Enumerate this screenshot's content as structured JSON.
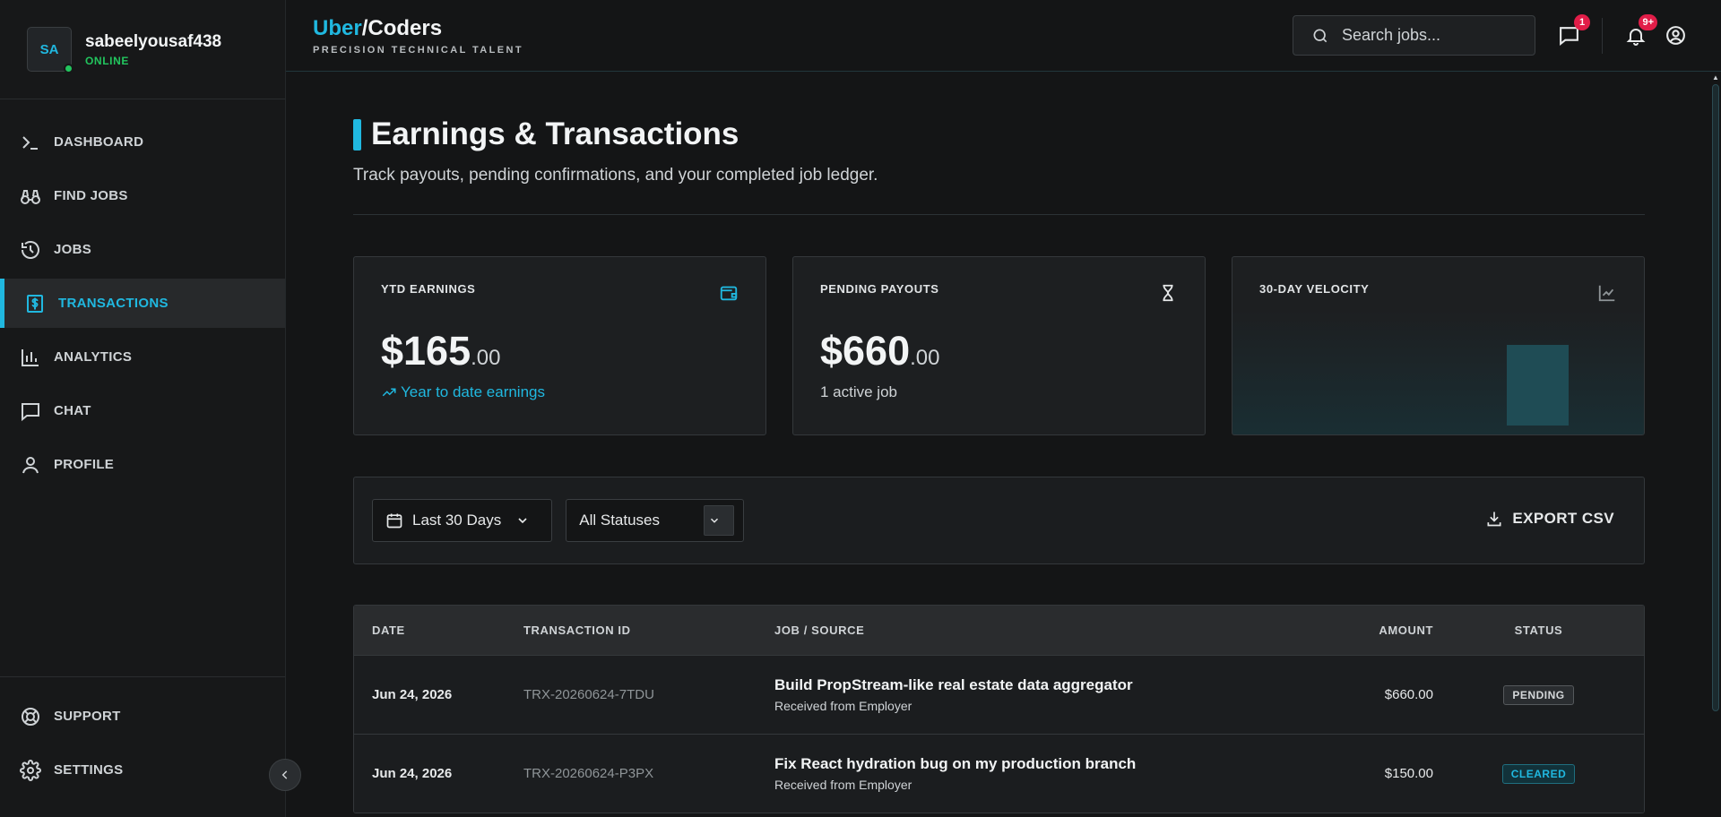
{
  "user": {
    "initials": "SA",
    "name": "sabeelyousaf438",
    "status": "ONLINE"
  },
  "nav": {
    "items": [
      {
        "label": "DASHBOARD",
        "icon": "terminal-icon"
      },
      {
        "label": "FIND JOBS",
        "icon": "binoculars-icon"
      },
      {
        "label": "JOBS",
        "icon": "history-icon"
      },
      {
        "label": "TRANSACTIONS",
        "icon": "dollar-receipt-icon",
        "active": true
      },
      {
        "label": "ANALYTICS",
        "icon": "bar-chart-icon"
      },
      {
        "label": "CHAT",
        "icon": "chat-icon"
      },
      {
        "label": "PROFILE",
        "icon": "user-icon"
      }
    ],
    "bottom": [
      {
        "label": "SUPPORT",
        "icon": "lifebuoy-icon"
      },
      {
        "label": "SETTINGS",
        "icon": "gear-icon"
      }
    ]
  },
  "brand": {
    "name_a": "Uber",
    "slash": "/",
    "name_b": "Coders",
    "tagline": "PRECISION TECHNICAL TALENT"
  },
  "topbar": {
    "search_placeholder": "Search jobs...",
    "chat_badge": "1",
    "notif_badge": "9+"
  },
  "page": {
    "title": "Earnings & Transactions",
    "subtitle": "Track payouts, pending confirmations, and your completed job ledger."
  },
  "cards": {
    "ytd": {
      "label": "YTD EARNINGS",
      "dollars": "$165",
      "cents": ".00",
      "note": "Year to date earnings"
    },
    "pending": {
      "label": "PENDING PAYOUTS",
      "dollars": "$660",
      "cents": ".00",
      "note": "1 active job"
    },
    "velocity": {
      "label": "30-DAY VELOCITY"
    }
  },
  "filters": {
    "date_range": "Last 30 Days",
    "status": "All Statuses",
    "export_label": "EXPORT CSV"
  },
  "table": {
    "headers": {
      "date": "DATE",
      "tx": "TRANSACTION ID",
      "job": "JOB / SOURCE",
      "amount": "AMOUNT",
      "status": "STATUS"
    },
    "rows": [
      {
        "date": "Jun 24, 2026",
        "tx": "TRX-20260624-7TDU",
        "job": "Build PropStream-like real estate data aggregator",
        "source": "Received from Employer",
        "amount": "$660.00",
        "status": "PENDING"
      },
      {
        "date": "Jun 24, 2026",
        "tx": "TRX-20260624-P3PX",
        "job": "Fix React hydration bug on my production branch",
        "source": "Received from Employer",
        "amount": "$150.00",
        "status": "CLEARED"
      }
    ]
  },
  "colors": {
    "accent": "#20b8e0",
    "online": "#22c55e",
    "badge": "#e11d48",
    "background": "#141516"
  }
}
